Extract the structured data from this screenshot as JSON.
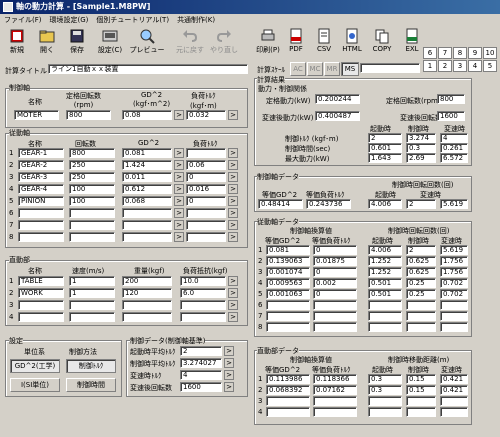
{
  "title": "軸の動力計算 - [Sample1.M8PW]",
  "menu": [
    "ファイル(F)",
    "環境設定(G)",
    "個別チュートリアル(T)",
    "共通制作(K)"
  ],
  "toolbar": [
    {
      "label": "新規",
      "icon": "new-file-icon"
    },
    {
      "label": "開く",
      "icon": "open-folder-icon"
    },
    {
      "label": "保存",
      "icon": "save-disk-icon"
    },
    {
      "label": "設定(C)",
      "icon": "settings-icon"
    },
    {
      "label": "プレビュー",
      "icon": "preview-icon"
    },
    {
      "label": "元に戻す",
      "icon": "undo-icon"
    },
    {
      "label": "やり直し",
      "icon": "redo-icon"
    },
    {
      "label": "印刷(P)",
      "icon": "printer-icon"
    },
    {
      "label": "PDF",
      "icon": "pdf-icon"
    },
    {
      "label": "CSV",
      "icon": "csv-icon"
    },
    {
      "label": "HTML",
      "icon": "html-icon"
    },
    {
      "label": "COPY",
      "icon": "copy-icon"
    },
    {
      "label": "EXL",
      "icon": "excel-icon"
    }
  ],
  "numgrid": [
    [
      "6",
      "7",
      "8",
      "9",
      "10"
    ],
    [
      "1",
      "2",
      "3",
      "4",
      "5"
    ]
  ],
  "calc_title": {
    "label": "計算タイトル",
    "value": "ライン1自動ｘｘ装置"
  },
  "unit_tabs": {
    "label": "計算ｽｹｰﾙ",
    "items": [
      "AC",
      "MC",
      "MR",
      "MS"
    ],
    "value": ""
  },
  "control_shaft": {
    "label": "制御軸",
    "headers": [
      "名称",
      "定格回転数\n(rpm)",
      "GD^2\n(kgf･m^2)",
      "負荷ﾄﾙｸ\n(kgf･m)"
    ],
    "row": {
      "name": "MOTER",
      "rpm": "800",
      "gd2": "0.08",
      "torque": "0.032"
    }
  },
  "driven_shaft": {
    "label": "従動軸",
    "headers": [
      "名称",
      "回転数",
      "GD^2",
      "負荷ﾄﾙｸ"
    ],
    "rows": [
      {
        "n": "1",
        "name": "GEAR-1",
        "rpm": "800",
        "gd2": "0.081",
        "torque": ""
      },
      {
        "n": "2",
        "name": "GEAR-2",
        "rpm": "250",
        "gd2": "1.424",
        "torque": "0.06"
      },
      {
        "n": "3",
        "name": "GEAR-3",
        "rpm": "250",
        "gd2": "0.011",
        "torque": "0"
      },
      {
        "n": "4",
        "name": "GEAR-4",
        "rpm": "100",
        "gd2": "0.612",
        "torque": "0.016"
      },
      {
        "n": "5",
        "name": "PINION",
        "rpm": "100",
        "gd2": "0.068",
        "torque": "0"
      },
      {
        "n": "6",
        "name": "",
        "rpm": "",
        "gd2": "",
        "torque": ""
      },
      {
        "n": "7",
        "name": "",
        "rpm": "",
        "gd2": "",
        "torque": ""
      },
      {
        "n": "8",
        "name": "",
        "rpm": "",
        "gd2": "",
        "torque": ""
      }
    ]
  },
  "linear": {
    "label": "直動部",
    "headers": [
      "名称",
      "速度(m/s)",
      "重量(kgf)",
      "負荷抵抗(kgf)"
    ],
    "rows": [
      {
        "n": "1",
        "name": "TABLE",
        "speed": "1",
        "weight": "200",
        "load": "10.0"
      },
      {
        "n": "2",
        "name": "WORK",
        "speed": "1",
        "weight": "120",
        "load": "6.0"
      },
      {
        "n": "3",
        "name": "",
        "speed": "",
        "weight": "",
        "load": ""
      },
      {
        "n": "4",
        "name": "",
        "speed": "",
        "weight": "",
        "load": ""
      }
    ]
  },
  "settings": {
    "label": "設定",
    "unit_label": "単位系",
    "method_label": "制御方法",
    "unit_buttons": [
      "GD^2(工学)",
      "I(SI単位)"
    ],
    "method_buttons": [
      "制御ﾄﾙｸ",
      "制御時間"
    ]
  },
  "control_data": {
    "label": "制御データ(制御軸基準)",
    "rows": [
      {
        "label": "起動時平均ﾄﾙｸ",
        "value": "2"
      },
      {
        "label": "制御時平均ﾄﾙｸ",
        "value": "3.274027"
      },
      {
        "label": "変速時ﾄﾙｸ",
        "value": "4"
      },
      {
        "label": "変速後回転数",
        "value": "1600"
      }
    ]
  },
  "results": {
    "label": "計算結果",
    "power_label": "動力・制御関係",
    "rated_power_label": "定格動力(kW)",
    "rated_power": "0.200244",
    "shift_power_label": "変速後動力(kW)",
    "shift_power": "0.400487",
    "rated_rpm_label": "定格回転数(rpm)",
    "rated_rpm": "800",
    "shift_rpm_label": "変速後回転数",
    "shift_rpm": "1600",
    "phase_headers": [
      "起動時",
      "制御時",
      "変速時"
    ],
    "phase_rows": [
      {
        "label": "制御ﾄﾙｸ (kgf･m)",
        "values": [
          "2",
          "3.274",
          "4"
        ]
      },
      {
        "label": "制御時間(sec)",
        "values": [
          "0.601",
          "0.3",
          "0.261"
        ]
      },
      {
        "label": "最大動力(kW)",
        "values": [
          "1.643",
          "2.69",
          "6.572"
        ]
      }
    ]
  },
  "ctrl_shaft_data": {
    "label": "制御軸データ",
    "headers": [
      "等価GD^2",
      "等価負荷ﾄﾙｸ",
      "起動時",
      "変速時"
    ],
    "group_header": "制御時回転回数(回)",
    "values": [
      "0.48414",
      "0.243736",
      "4.006",
      "2",
      "5.619"
    ]
  },
  "driven_data": {
    "label": "従動軸データ",
    "group1": "制御軸換算値",
    "group2": "制御時回転回数(回)",
    "headers": [
      "等価GD^2",
      "等価負荷ﾄﾙｸ",
      "起動時",
      "制御時",
      "変速時"
    ],
    "rows": [
      {
        "n": "1",
        "v": [
          "0.081",
          "0",
          "4.006",
          "2",
          "5.619"
        ]
      },
      {
        "n": "2",
        "v": [
          "0.139063",
          "0.01875",
          "1.252",
          "0.625",
          "1.756"
        ]
      },
      {
        "n": "3",
        "v": [
          "0.001074",
          "0",
          "1.252",
          "0.625",
          "1.756"
        ]
      },
      {
        "n": "4",
        "v": [
          "0.009563",
          "0.002",
          "0.501",
          "0.25",
          "0.702"
        ]
      },
      {
        "n": "5",
        "v": [
          "0.001063",
          "0",
          "0.501",
          "0.25",
          "0.702"
        ]
      },
      {
        "n": "6",
        "v": [
          "",
          "",
          "",
          "",
          ""
        ]
      },
      {
        "n": "7",
        "v": [
          "",
          "",
          "",
          "",
          ""
        ]
      },
      {
        "n": "8",
        "v": [
          "",
          "",
          "",
          "",
          ""
        ]
      }
    ]
  },
  "linear_data": {
    "label": "直動部データ",
    "group1": "制御軸換算値",
    "group2": "制御時移動距離(m)",
    "headers": [
      "等価GD^2",
      "等価負荷ﾄﾙｸ",
      "起動時",
      "制御時",
      "変速時"
    ],
    "rows": [
      {
        "n": "1",
        "v": [
          "0.113986",
          "0.118366",
          "0.3",
          "0.15",
          "0.421"
        ]
      },
      {
        "n": "2",
        "v": [
          "0.068392",
          "0.07162",
          "0.3",
          "0.15",
          "0.421"
        ]
      },
      {
        "n": "3",
        "v": [
          "",
          "",
          "",
          "",
          ""
        ]
      },
      {
        "n": "4",
        "v": [
          "",
          "",
          "",
          "",
          ""
        ]
      }
    ]
  }
}
